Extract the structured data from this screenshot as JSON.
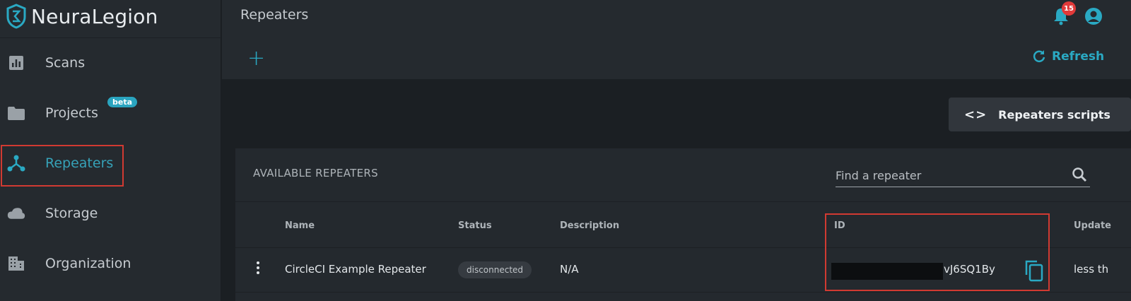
{
  "brand": {
    "name": "NeuraLegion"
  },
  "sidebar": {
    "items": [
      {
        "label": "Scans",
        "icon": "bar-chart-icon"
      },
      {
        "label": "Projects",
        "icon": "folder-icon",
        "badge": "beta"
      },
      {
        "label": "Repeaters",
        "icon": "repeater-icon",
        "active": true
      },
      {
        "label": "Storage",
        "icon": "cloud-icon"
      },
      {
        "label": "Organization",
        "icon": "building-icon"
      }
    ]
  },
  "header": {
    "title": "Repeaters",
    "notifications_count": "15",
    "add_label": "+",
    "refresh_label": "Refresh"
  },
  "main": {
    "scripts_button_label": "Repeaters scripts",
    "scripts_icon_glyph": "<>",
    "card_title": "AVAILABLE REPEATERS",
    "search": {
      "placeholder": "Find a repeater",
      "value": ""
    },
    "table": {
      "columns": [
        "Name",
        "Status",
        "Description",
        "ID",
        "Update"
      ],
      "rows": [
        {
          "name": "CircleCI Example Repeater",
          "status": "disconnected",
          "description": "N/A",
          "id_visible": "vJ6SQ1By",
          "updated": "less th"
        }
      ]
    }
  },
  "colors": {
    "accent": "#2aa9c3",
    "highlight": "#d13a32",
    "badge_red": "#e03a3a"
  }
}
